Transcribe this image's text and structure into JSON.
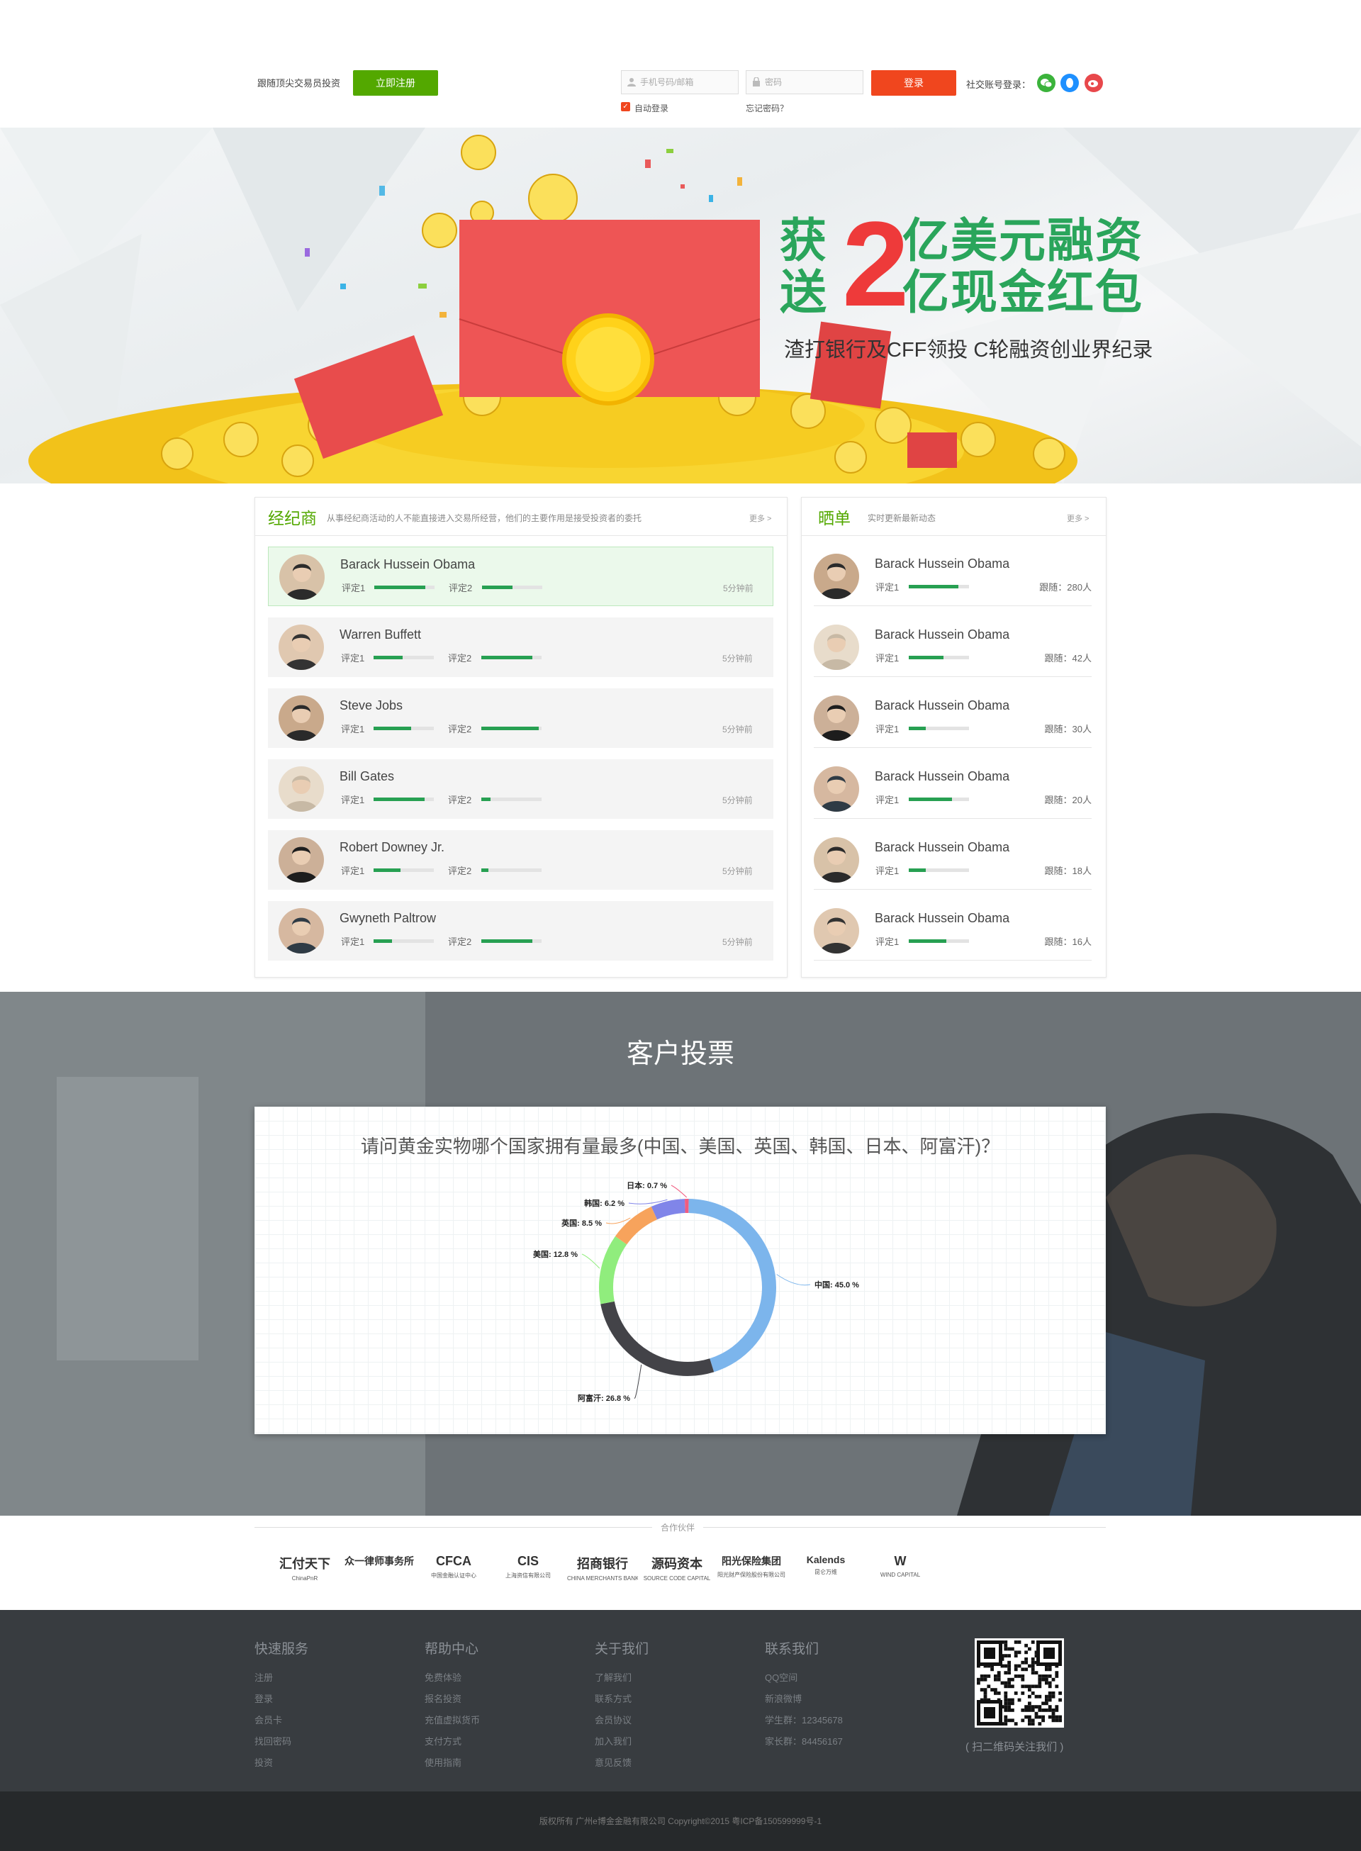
{
  "header": {
    "tagline": "跟随顶尖交易员投资",
    "register_label": "立即注册",
    "phone_placeholder": "手机号码/邮箱",
    "password_placeholder": "密码",
    "login_label": "登录",
    "auto_login": "自动登录",
    "forgot_password": "忘记密码？",
    "social_login": "社交账号登录："
  },
  "banner": {
    "line1_prefix": "获",
    "line2_prefix": "送",
    "big_number": "2",
    "line1_suffix": "亿美元融资",
    "line2_suffix": "亿现金红包",
    "subtitle": "渣打银行及CFF领投  C轮融资创业界纪录"
  },
  "brokers": {
    "title": "经纪商",
    "description": "从事经纪商活动的人不能直接进入交易所经营，他们的主要作用是接受投资者的委托",
    "more": "更多 >",
    "items": [
      {
        "name": "Barack Hussein Obama",
        "label1": "评定1",
        "label2": "评定2",
        "r1": 0.85,
        "r2": 0.5,
        "time": "5分钟前"
      },
      {
        "name": "Warren Buffett",
        "label1": "评定1",
        "label2": "评定2",
        "r1": 0.48,
        "r2": 0.85,
        "time": "5分钟前"
      },
      {
        "name": "Steve Jobs",
        "label1": "评定1",
        "label2": "评定2",
        "r1": 0.62,
        "r2": 0.95,
        "time": "5分钟前"
      },
      {
        "name": "Bill Gates",
        "label1": "评定1",
        "label2": "评定2",
        "r1": 0.85,
        "r2": 0.15,
        "time": "5分钟前"
      },
      {
        "name": "Robert Downey Jr.",
        "label1": "评定1",
        "label2": "评定2",
        "r1": 0.45,
        "r2": 0.12,
        "time": "5分钟前"
      },
      {
        "name": "Gwyneth Paltrow",
        "label1": "评定1",
        "label2": "评定2",
        "r1": 0.3,
        "r2": 0.85,
        "time": "5分钟前"
      }
    ]
  },
  "showcase": {
    "title": "晒单",
    "description": "实时更新最新动态",
    "more": "更多 >",
    "items": [
      {
        "name": "Barack Hussein Obama",
        "label1": "评定1",
        "r1": 0.82,
        "follow": "跟随：280人"
      },
      {
        "name": "Barack Hussein Obama",
        "label1": "评定1",
        "r1": 0.58,
        "follow": "跟随：42人"
      },
      {
        "name": "Barack Hussein Obama",
        "label1": "评定1",
        "r1": 0.28,
        "follow": "跟随：30人"
      },
      {
        "name": "Barack Hussein Obama",
        "label1": "评定1",
        "r1": 0.72,
        "follow": "跟随：20人"
      },
      {
        "name": "Barack Hussein Obama",
        "label1": "评定1",
        "r1": 0.28,
        "follow": "跟随：18人"
      },
      {
        "name": "Barack Hussein Obama",
        "label1": "评定1",
        "r1": 0.62,
        "follow": "跟随：16人"
      }
    ]
  },
  "vote": {
    "title": "客户投票",
    "question": "请问黄金实物哪个国家拥有量最多(中国、美国、英国、韩国、日本、阿富汗)？"
  },
  "chart_data": {
    "type": "pie",
    "categories": [
      "中国",
      "阿富汗",
      "美国",
      "英国",
      "韩国",
      "日本"
    ],
    "values": [
      45.0,
      26.8,
      12.8,
      8.5,
      6.2,
      0.7
    ],
    "labels": [
      "中国: 45.0 %",
      "阿富汗: 26.8 %",
      "美国: 12.8 %",
      "英国: 8.5 %",
      "韩国: 6.2 %",
      "日本: 0.7 %"
    ],
    "colors": [
      "#7cb5ec",
      "#434348",
      "#90ed7d",
      "#f7a35c",
      "#8085e9",
      "#f15c80"
    ]
  },
  "partners": {
    "label": "合作伙伴",
    "logos": [
      {
        "name": "汇付天下",
        "sub": "ChinaPnR"
      },
      {
        "name": "众一律师事务所",
        "sub": ""
      },
      {
        "name": "CFCA",
        "sub": "中国金融认证中心"
      },
      {
        "name": "CIS",
        "sub": "上海资信有限公司"
      },
      {
        "name": "招商银行",
        "sub": "CHINA MERCHANTS BANK"
      },
      {
        "name": "源码资本",
        "sub": "SOURCE CODE CAPITAL"
      },
      {
        "name": "阳光保险集团",
        "sub": "阳光财产保险股份有限公司"
      },
      {
        "name": "Kalends",
        "sub": "昆仑万维"
      },
      {
        "name": "W",
        "sub": "WIND CAPITAL"
      }
    ]
  },
  "footer": {
    "columns": [
      {
        "title": "快速服务",
        "links": [
          "注册",
          "登录",
          "会员卡",
          "找回密码",
          "投资"
        ]
      },
      {
        "title": "帮助中心",
        "links": [
          "免费体验",
          "报名投资",
          "充值虚拟货币",
          "支付方式",
          "使用指南"
        ]
      },
      {
        "title": "关于我们",
        "links": [
          "了解我们",
          "联系方式",
          "会员协议",
          "加入我们",
          "意见反馈"
        ]
      },
      {
        "title": "联系我们",
        "links": [
          "QQ空间",
          "新浪微博",
          "学生群：12345678",
          "家长群：84456167"
        ]
      }
    ],
    "qr_caption": "( 扫二维码关注我们 )",
    "copyright": "版权所有 广州e博金金融有限公司 Copyright©2015 粤ICP备150599999号-1"
  }
}
